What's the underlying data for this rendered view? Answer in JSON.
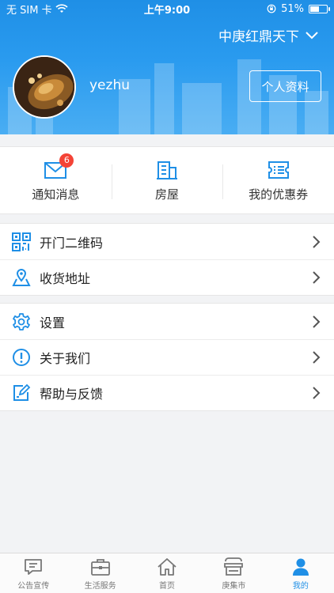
{
  "status_bar": {
    "carrier": "无 SIM 卡",
    "time": "上午9:00",
    "battery": "51%",
    "battery_level": 0.51
  },
  "header": {
    "community": "中庚红鼎天下",
    "username": "yezhu",
    "profile_button": "个人资料"
  },
  "quick_actions": [
    {
      "label": "通知消息",
      "icon": "mail-icon",
      "badge": "6"
    },
    {
      "label": "房屋",
      "icon": "building-icon"
    },
    {
      "label": "我的优惠券",
      "icon": "coupon-list-icon"
    }
  ],
  "menu_group_1": [
    {
      "label": "开门二维码",
      "icon": "qr-code-icon"
    },
    {
      "label": "收货地址",
      "icon": "location-pin-icon"
    }
  ],
  "menu_group_2": [
    {
      "label": "设置",
      "icon": "gear-icon"
    },
    {
      "label": "关于我们",
      "icon": "info-icon"
    },
    {
      "label": "帮助与反馈",
      "icon": "feedback-edit-icon"
    }
  ],
  "tabbar": [
    {
      "label": "公告宣传",
      "icon": "chat-bubble-icon"
    },
    {
      "label": "生活服务",
      "icon": "briefcase-icon"
    },
    {
      "label": "首页",
      "icon": "home-icon"
    },
    {
      "label": "庚集市",
      "icon": "store-icon"
    },
    {
      "label": "我的",
      "icon": "person-icon",
      "active": true
    }
  ],
  "colors": {
    "accent": "#1f8fe6",
    "badge": "#f44336"
  }
}
